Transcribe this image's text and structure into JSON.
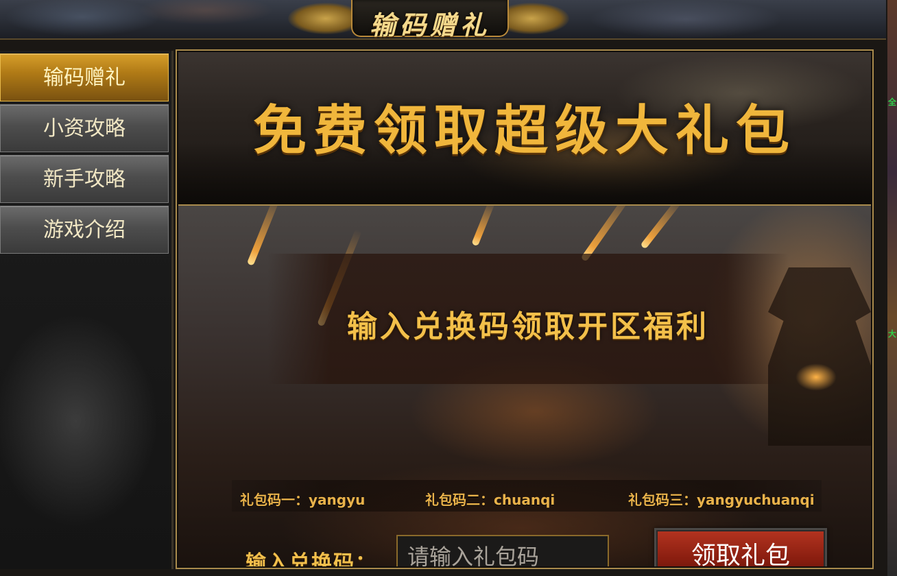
{
  "header": {
    "title": "输码赠礼"
  },
  "sidebar": {
    "items": [
      {
        "label": "输码赠礼",
        "active": true
      },
      {
        "label": "小资攻略",
        "active": false
      },
      {
        "label": "新手攻略",
        "active": false
      },
      {
        "label": "游戏介绍",
        "active": false
      }
    ]
  },
  "banner": {
    "text": "免费领取超级大礼包"
  },
  "panel": {
    "headline": "输入兑换码领取开区福利",
    "codes": [
      "礼包码一：yangyu",
      "礼包码二：chuanqi",
      "礼包码三：yangyuchuanqi"
    ],
    "input_label": "输入兑换码：",
    "input_placeholder": "请输入礼包码",
    "input_value": "",
    "claim_button": "领取礼包"
  },
  "edge_glyphs": [
    "全",
    "大"
  ],
  "colors": {
    "gold": "#f0b63c",
    "active_tab": "#d69e2a",
    "button_red": "#b43420",
    "frame_border": "#a98a4c"
  }
}
